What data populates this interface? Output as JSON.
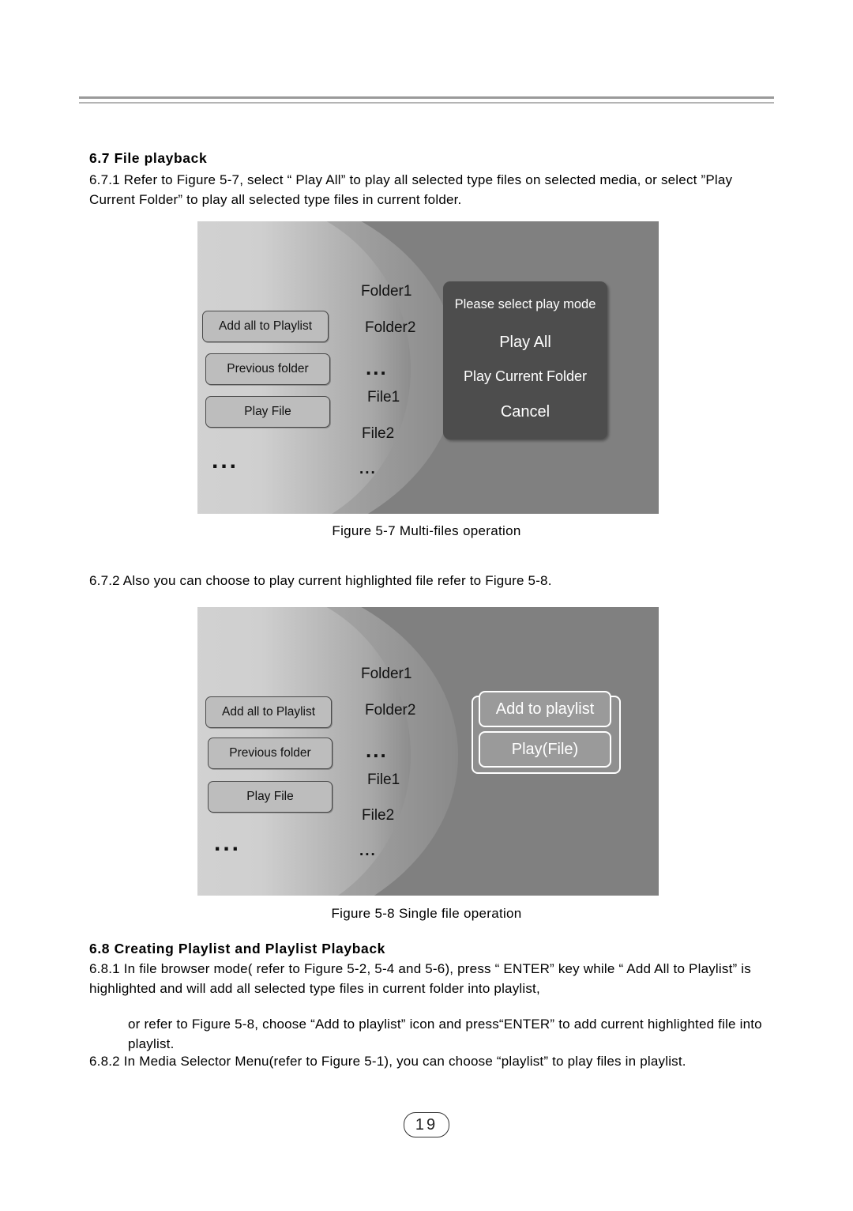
{
  "document": {
    "page_number": "19",
    "section_67": {
      "heading": "6.7 File playback",
      "item_671": "6.7.1 Refer to Figure 5-7, select “ Play All” to play all selected type files on selected media,  or select ”Play Current Folder” to play all selected type files in current folder.",
      "caption_57": "Figure 5-7  Multi-files operation",
      "item_672": "6.7.2 Also you can choose to play current highlighted file refer to Figure 5-8.",
      "caption_58": "Figure 5-8  Single file operation"
    },
    "section_68": {
      "heading": "6.8 Creating Playlist and Playlist Playback",
      "item_681_a": "6.8.1 In file browser mode( refer to  Figure 5-2, 5-4 and 5-6), press “ ENTER” key while “ Add All to Playlist” is highlighted and will add all selected type files in current folder into playlist,",
      "item_681_b": "or refer to Figure 5-8, choose “Add to playlist” icon and press“ENTER” to add current highlighted file into playlist.",
      "item_682": "6.8.2 In Media Selector Menu(refer to Figure 5-1), you can choose “playlist” to play files in playlist."
    }
  },
  "figure57": {
    "buttons": [
      "Add all to Playlist",
      "Previous folder",
      "Play File"
    ],
    "left_dots": "...",
    "files": [
      "Folder1",
      "Folder2",
      "File1",
      "File2"
    ],
    "file_dots_mid": "...",
    "file_dots_end": "...",
    "dialog": {
      "title": "Please select play mode",
      "options": [
        "Play All",
        "Play Current  Folder",
        "Cancel"
      ]
    }
  },
  "figure58": {
    "buttons": [
      "Add all to Playlist",
      "Previous folder",
      "Play File"
    ],
    "left_dots": "...",
    "files": [
      "Folder1",
      "Folder2",
      "File1",
      "File2"
    ],
    "file_dots_mid": "...",
    "file_dots_end": "...",
    "icons": [
      "Add to playlist",
      "Play(File)"
    ]
  }
}
